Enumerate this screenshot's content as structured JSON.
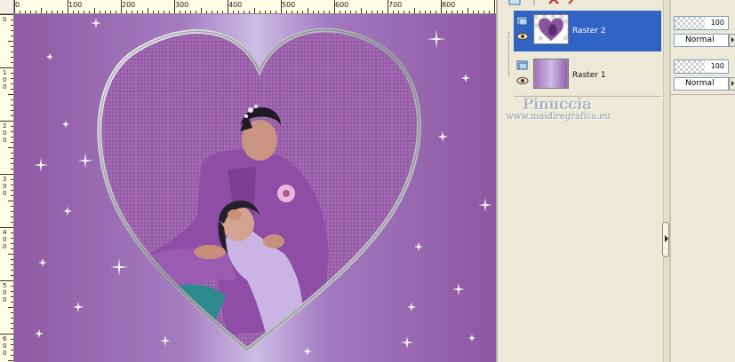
{
  "rulers": {
    "horizontal": [
      "0",
      "100",
      "200",
      "300",
      "400",
      "500",
      "600",
      "700",
      "800"
    ],
    "vertical": [
      "0",
      "100",
      "200",
      "300",
      "400",
      "500",
      "600"
    ]
  },
  "layers": [
    {
      "name": "Raster 2",
      "selected": true,
      "opacity": "100",
      "blend_mode": "Normal"
    },
    {
      "name": "Raster 1",
      "selected": false,
      "opacity": "100",
      "blend_mode": "Normal"
    }
  ],
  "watermark": {
    "name": "Pinuccia",
    "site": "www.maidiregrafica.eu"
  },
  "colors": {
    "background_purple": "#9a62aa",
    "selection_blue": "#3163c5",
    "panel_gray": "#ece9d8"
  }
}
